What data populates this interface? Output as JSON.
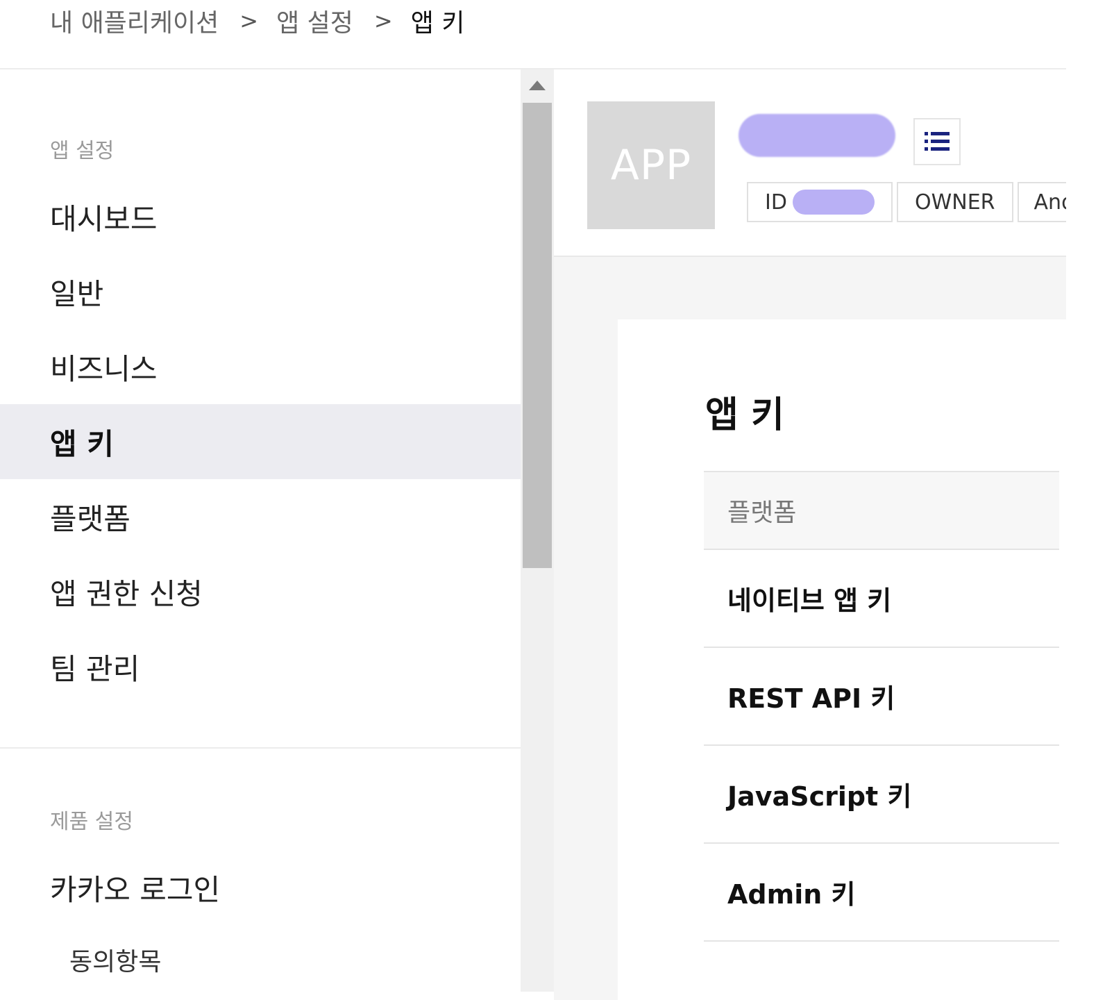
{
  "breadcrumb": {
    "items": [
      "내 애플리케이션",
      "앱 설정",
      "앱 키"
    ],
    "separator": ">"
  },
  "sidebar": {
    "section_app_settings": "앱 설정",
    "items": [
      {
        "label": "대시보드"
      },
      {
        "label": "일반"
      },
      {
        "label": "비즈니스"
      },
      {
        "label": "앱 키",
        "active": true
      },
      {
        "label": "플랫폼"
      },
      {
        "label": "앱 권한 신청"
      },
      {
        "label": "팀 관리"
      }
    ],
    "section_product_settings": "제품 설정",
    "product_items": [
      {
        "label": "카카오 로그인"
      }
    ],
    "sub_items": [
      {
        "label": "동의항목"
      }
    ]
  },
  "app": {
    "icon_text": "APP",
    "tags": {
      "id_label": "ID",
      "owner_label": "OWNER",
      "platform_label": "And"
    },
    "menu_icon": "list-icon",
    "redaction_color": "#b9b0f5"
  },
  "main": {
    "title": "앱 키",
    "table": {
      "header": "플랫폼",
      "rows": [
        "네이티브 앱 키",
        "REST API 키",
        "JavaScript 키",
        "Admin 키"
      ]
    }
  },
  "colors": {
    "active_bg": "#ececf1",
    "content_bg": "#f5f5f5",
    "icon_navy": "#1a237e"
  }
}
